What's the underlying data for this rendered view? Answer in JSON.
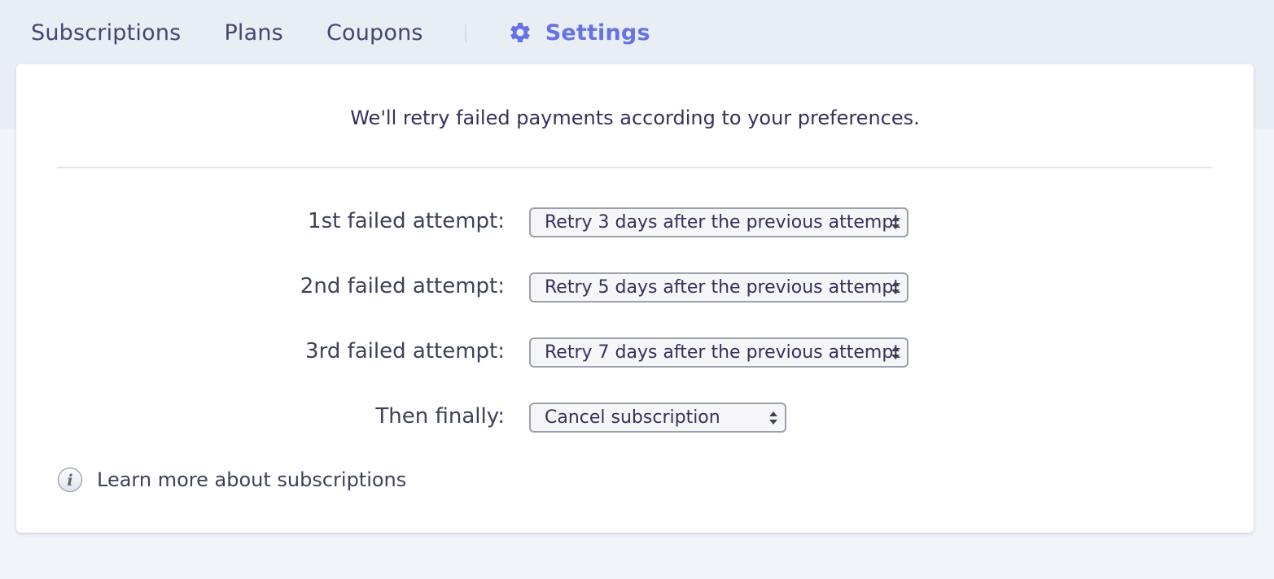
{
  "nav": {
    "items": [
      {
        "label": "Subscriptions"
      },
      {
        "label": "Plans"
      },
      {
        "label": "Coupons"
      }
    ],
    "active": {
      "label": "Settings",
      "icon": "gear-icon"
    },
    "accent_color": "#6772e5"
  },
  "card": {
    "intro": "We'll retry failed payments according to your preferences.",
    "rows": [
      {
        "label": "1st failed attempt:",
        "selected": "Retry 3 days after the previous attempt"
      },
      {
        "label": "2nd failed attempt:",
        "selected": "Retry 5 days after the previous attempt"
      },
      {
        "label": "3rd failed attempt:",
        "selected": "Retry 7 days after the previous attempt"
      },
      {
        "label": "Then finally:",
        "selected": "Cancel subscription"
      }
    ],
    "learn_more": {
      "label": "Learn more about subscriptions",
      "icon": "info-icon"
    }
  }
}
